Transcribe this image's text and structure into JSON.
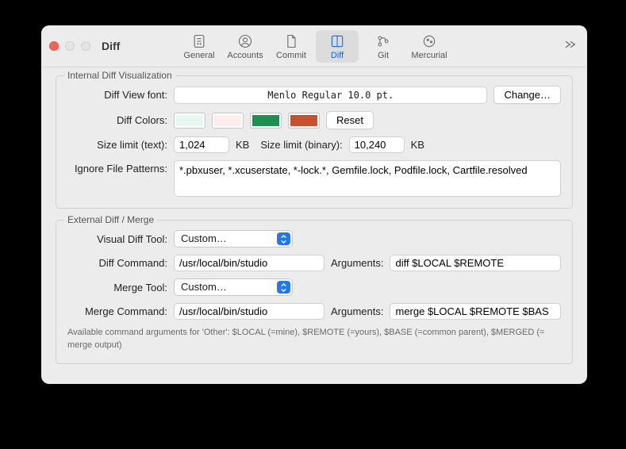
{
  "window": {
    "title": "Diff"
  },
  "toolbar": {
    "tabs": {
      "general": "General",
      "accounts": "Accounts",
      "commit": "Commit",
      "diff": "Diff",
      "git": "Git",
      "mercurial": "Mercurial"
    },
    "selected": "diff"
  },
  "internal": {
    "legend": "Internal Diff Visualization",
    "font_label": "Diff View font:",
    "font_value": "Menlo Regular 10.0 pt.",
    "change_button": "Change…",
    "colors_label": "Diff Colors:",
    "colors": {
      "added_light": "#e6f7ee",
      "removed_light": "#fdecec",
      "added_dark": "#1f8f54",
      "removed_dark": "#c9502e"
    },
    "reset_button": "Reset",
    "size_text_label": "Size limit (text):",
    "size_text_value": "1,024",
    "size_text_unit": "KB",
    "size_binary_label": "Size limit (binary):",
    "size_binary_value": "10,240",
    "size_binary_unit": "KB",
    "ignore_label": "Ignore File Patterns:",
    "ignore_value": "*.pbxuser, *.xcuserstate, *-lock.*, Gemfile.lock, Podfile.lock, Cartfile.resolved"
  },
  "external": {
    "legend": "External Diff / Merge",
    "visual_tool_label": "Visual Diff Tool:",
    "visual_tool_value": "Custom…",
    "diff_cmd_label": "Diff Command:",
    "diff_cmd_value": "/usr/local/bin/studio",
    "diff_args_label": "Arguments:",
    "diff_args_value": "diff $LOCAL $REMOTE",
    "merge_tool_label": "Merge Tool:",
    "merge_tool_value": "Custom…",
    "merge_cmd_label": "Merge Command:",
    "merge_cmd_value": "/usr/local/bin/studio",
    "merge_args_label": "Arguments:",
    "merge_args_value": "merge $LOCAL $REMOTE $BAS",
    "hint": "Available command arguments for 'Other': $LOCAL (=mine), $REMOTE (=yours), $BASE (=common parent), $MERGED (= merge output)"
  }
}
